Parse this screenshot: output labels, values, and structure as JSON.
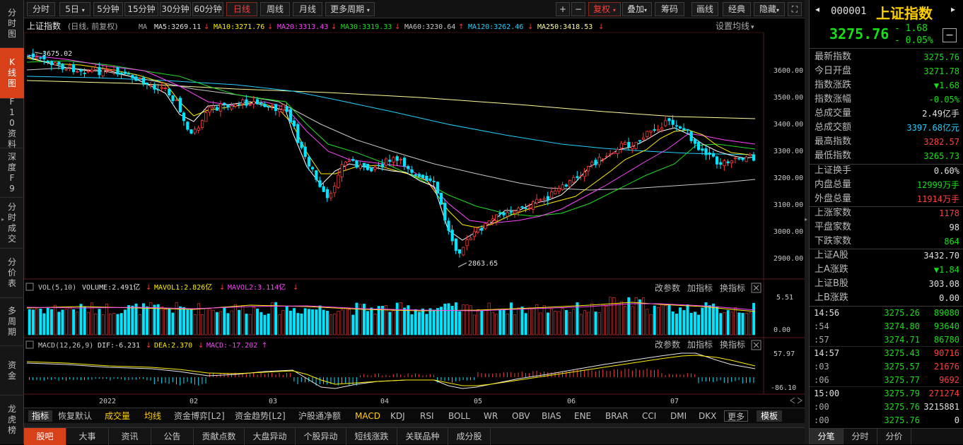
{
  "nav": {
    "items": [
      {
        "label": "分时图"
      },
      {
        "label": "K线图"
      },
      {
        "label": "F10资料"
      },
      {
        "label": "深度F9"
      },
      {
        "label": "分时成交"
      },
      {
        "label": "分价表"
      },
      {
        "label": "多周期"
      },
      {
        "label": "资金"
      },
      {
        "label": "龙虎榜"
      }
    ]
  },
  "toolbar": {
    "periods": [
      "分时",
      "5日",
      "5分钟",
      "15分钟",
      "30分钟",
      "60分钟",
      "日线",
      "周线",
      "月线",
      "更多周期"
    ],
    "right_buttons": [
      "+",
      "−",
      "复权",
      "叠加",
      "筹码",
      "画线",
      "经典",
      "隐藏"
    ],
    "fuquan": "复权",
    "plus": "+",
    "minus": "−",
    "expand": "⛶"
  },
  "ma_bar": {
    "title": "上证指数",
    "mode": "(日线, 前复权)",
    "ma": "MA",
    "ma5": "MA5:3269.11",
    "ma10": "MA10:3271.76",
    "ma20": "MA20:3313.43",
    "ma30": "MA30:3319.33",
    "ma60": "MA60:3230.64",
    "ma120": "MA120:3262.46",
    "ma250": "MA250:3418.53",
    "settings": "设置均线"
  },
  "price_axis": [
    "3600.00",
    "3500.00",
    "3400.00",
    "3300.00",
    "3200.00",
    "3100.00",
    "3000.00",
    "2900.00"
  ],
  "annotations": {
    "high": "3675.02",
    "low": "2863.65"
  },
  "vol_bar": {
    "label": "VOL(5,10)",
    "volume": "VOLUME:2.491亿",
    "mavol1": "MAVOL1:2.826亿",
    "mavol2": "MAVOL2:3.114亿",
    "axis": [
      "5.51",
      "0.00"
    ]
  },
  "macd_bar": {
    "label": "MACD(12,26,9)",
    "dif": "DIF:-6.231",
    "dea": "DEA:2.370",
    "macd": "MACD:-17.202",
    "axis": [
      "57.97",
      "-86.10"
    ]
  },
  "sub_actions": [
    "改参数",
    "加指标",
    "换指标"
  ],
  "x_axis": {
    "labels": [
      "2022",
      "02",
      "03",
      "04",
      "05",
      "06",
      "07"
    ]
  },
  "indicators": {
    "items": [
      "指标",
      "恢复默认",
      "成交量",
      "均线",
      "资金博弈[L2]",
      "资金趋势[L2]",
      "沪股通净额",
      "MACD",
      "KDJ",
      "RSI",
      "BOLL",
      "WR",
      "OBV",
      "BIAS",
      "ENE",
      "BRAR",
      "CCI",
      "DMI",
      "DKX",
      "更多",
      "模板"
    ]
  },
  "bottom_tabs": {
    "items": [
      "股吧",
      "大事",
      "资讯",
      "公告",
      "贡献点数",
      "大盘异动",
      "个股异动",
      "短线涨跌",
      "关联品种",
      "成分股"
    ]
  },
  "quote": {
    "code": "000001",
    "name": "上证指数",
    "price": "3275.76",
    "change": "- 1.68",
    "change_pct": "- 0.05%",
    "minimize": "−"
  },
  "stats": [
    {
      "label": "最新指数",
      "value": "3275.76",
      "color": "#14e014"
    },
    {
      "label": "今日开盘",
      "value": "3271.78",
      "color": "#14e014"
    },
    {
      "label": "指数涨跌",
      "value": "▼1.68",
      "color": "#14e014"
    },
    {
      "label": "指数涨幅",
      "value": "-0.05%",
      "color": "#14e014"
    },
    {
      "label": "总成交量",
      "value": "2.49亿手",
      "color": "#e0e0e0"
    },
    {
      "label": "总成交额",
      "value": "3397.68亿元",
      "color": "#21d0ff"
    },
    {
      "label": "最高指数",
      "value": "3282.57",
      "color": "#ff4040"
    },
    {
      "label": "最低指数",
      "value": "3265.73",
      "color": "#14e014"
    }
  ],
  "stats2": [
    {
      "label": "上证换手",
      "value": "0.60%",
      "color": "#e0e0e0"
    },
    {
      "label": "内盘总量",
      "value": "12999万手",
      "color": "#14e014"
    },
    {
      "label": "外盘总量",
      "value": "11914万手",
      "color": "#ff4040"
    }
  ],
  "stats3": [
    {
      "label": "上涨家数",
      "value": "1178",
      "color": "#ff4040"
    },
    {
      "label": "平盘家数",
      "value": "98",
      "color": "#e0e0e0"
    },
    {
      "label": "下跌家数",
      "value": "864",
      "color": "#14e014"
    }
  ],
  "stats4": [
    {
      "label": "上证A股",
      "value": "3432.70",
      "color": "#e0e0e0"
    },
    {
      "label": "上A涨跌",
      "value": "▼1.84",
      "color": "#14e014"
    },
    {
      "label": "上证B股",
      "value": "303.08",
      "color": "#e0e0e0"
    },
    {
      "label": "上B涨跌",
      "value": "0.00",
      "color": "#e0e0e0"
    }
  ],
  "ticks": [
    {
      "time": "14:56",
      "price": "3275.26",
      "vol": "89080",
      "vcolor": "#14e014",
      "tcolor": "#e0e0e0"
    },
    {
      "time": ":54",
      "price": "3274.80",
      "vol": "93640",
      "vcolor": "#14e014",
      "tcolor": "#aaaaaa"
    },
    {
      "time": ":57",
      "price": "3274.71",
      "vol": "86780",
      "vcolor": "#14e014",
      "tcolor": "#aaaaaa"
    },
    {
      "time": "14:57",
      "price": "3275.43",
      "vol": "90716",
      "vcolor": "#ff4040",
      "tcolor": "#e0e0e0"
    },
    {
      "time": ":03",
      "price": "3275.57",
      "vol": "21676",
      "vcolor": "#ff4040",
      "tcolor": "#aaaaaa"
    },
    {
      "time": ":06",
      "price": "3275.77",
      "vol": "9692",
      "vcolor": "#ff4040",
      "tcolor": "#aaaaaa"
    },
    {
      "time": "15:00",
      "price": "3275.79",
      "vol": "271274",
      "vcolor": "#ff4040",
      "tcolor": "#e0e0e0"
    },
    {
      "time": ":00",
      "price": "3275.76",
      "vol": "3215881",
      "vcolor": "#e0e0e0",
      "tcolor": "#aaaaaa"
    },
    {
      "time": ":00",
      "price": "3275.76",
      "vol": "0",
      "vcolor": "#e0e0e0",
      "tcolor": "#aaaaaa"
    }
  ],
  "right_tabs": {
    "items": [
      "分笔",
      "分时",
      "分价"
    ]
  },
  "colors": {
    "up": "#ff3b3b",
    "down": "#00e5ff",
    "accent": "#d8401a",
    "green": "#14e014"
  }
}
